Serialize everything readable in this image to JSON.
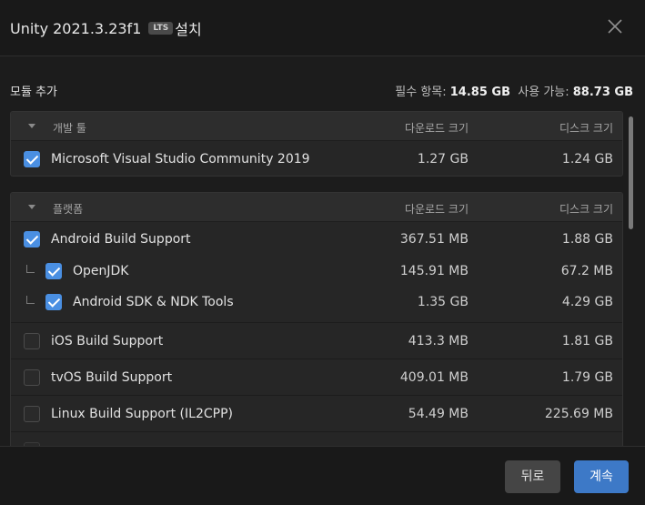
{
  "header": {
    "title": "Unity 2021.3.23f1",
    "badge": "LTS",
    "title_suffix": "설치"
  },
  "modules": {
    "heading": "모듈 추가",
    "required_label": "필수 항목:",
    "required_value": "14.85 GB",
    "available_label": "사용 가능:",
    "available_value": "88.73 GB"
  },
  "sections": [
    {
      "name": "개발 툴",
      "download_header": "다운로드 크기",
      "disk_header": "디스크 크기",
      "rows": [
        {
          "name": "Microsoft Visual Studio Community 2019",
          "download": "1.27 GB",
          "disk": "1.24 GB",
          "checked": true
        }
      ]
    },
    {
      "name": "플랫폼",
      "download_header": "다운로드 크기",
      "disk_header": "디스크 크기",
      "rows": [
        {
          "name": "Android Build Support",
          "download": "367.51 MB",
          "disk": "1.88 GB",
          "checked": true
        },
        {
          "name": "OpenJDK",
          "download": "145.91 MB",
          "disk": "67.2 MB",
          "checked": true,
          "child": true
        },
        {
          "name": "Android SDK & NDK Tools",
          "download": "1.35 GB",
          "disk": "4.29 GB",
          "checked": true,
          "child": true
        },
        {
          "name": "iOS Build Support",
          "download": "413.3 MB",
          "disk": "1.81 GB",
          "checked": false
        },
        {
          "name": "tvOS Build Support",
          "download": "409.01 MB",
          "disk": "1.79 GB",
          "checked": false
        },
        {
          "name": "Linux Build Support (IL2CPP)",
          "download": "54.49 MB",
          "disk": "225.69 MB",
          "checked": false
        }
      ]
    }
  ],
  "footer": {
    "back_label": "뒤로",
    "continue_label": "계속"
  },
  "colors": {
    "accent": "#3d79c7",
    "checkbox_checked": "#4a8fe2",
    "background": "#1c1c1c"
  },
  "icons": [
    "close-icon",
    "collapse-triangle-icon",
    "checkbox-check-icon",
    "tree-branch-icon"
  ]
}
